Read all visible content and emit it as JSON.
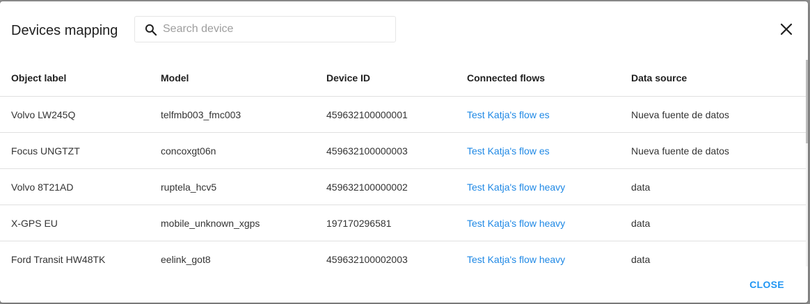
{
  "dialog": {
    "title": "Devices mapping",
    "close_button_label": "CLOSE"
  },
  "search": {
    "placeholder": "Search device",
    "value": ""
  },
  "colors": {
    "link": "#1e88e5",
    "accent": "#2196f3"
  },
  "icons": {
    "search": "search-icon",
    "close": "close-icon"
  },
  "table": {
    "headers": [
      "Object label",
      "Model",
      "Device ID",
      "Connected flows",
      "Data source"
    ],
    "rows": [
      {
        "label": "Volvo LW245Q",
        "model": "telfmb003_fmc003",
        "device_id": "459632100000001",
        "flow": "Test Katja's flow es",
        "source": "Nueva fuente de datos"
      },
      {
        "label": "Focus UNGTZT",
        "model": "concoxgt06n",
        "device_id": "459632100000003",
        "flow": "Test Katja's flow es",
        "source": "Nueva fuente de datos"
      },
      {
        "label": "Volvo 8T21AD",
        "model": "ruptela_hcv5",
        "device_id": "459632100000002",
        "flow": "Test Katja's flow heavy",
        "source": "data"
      },
      {
        "label": "X-GPS EU",
        "model": "mobile_unknown_xgps",
        "device_id": "197170296581",
        "flow": "Test Katja's flow heavy",
        "source": "data"
      },
      {
        "label": "Ford Transit HW48TK",
        "model": "eelink_got8",
        "device_id": "459632100002003",
        "flow": "Test Katja's flow heavy",
        "source": "data"
      }
    ]
  }
}
